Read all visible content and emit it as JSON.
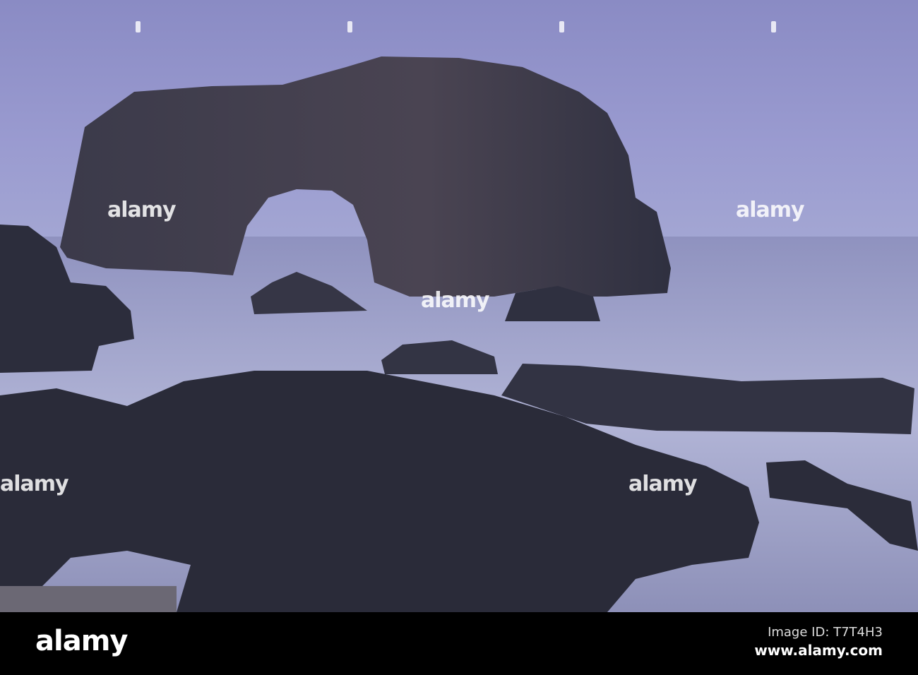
{
  "watermark": {
    "text": "alamy"
  },
  "footer": {
    "logo": "alamy",
    "image_id": "Image ID: T7T4H3",
    "url": "www.alamy.com"
  },
  "colors": {
    "sky": "#8c8fc6",
    "sea": "#a9abcf",
    "rock": "#2e2f3f",
    "bar": "#000000"
  }
}
